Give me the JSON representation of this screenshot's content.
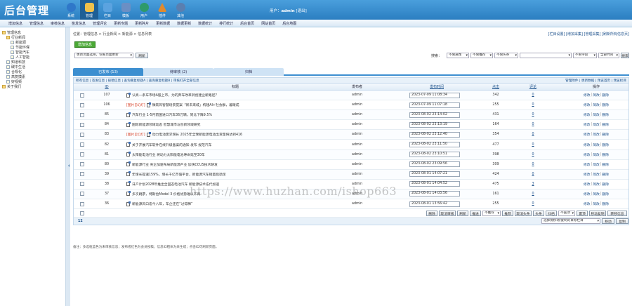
{
  "app": {
    "title": "后台管理"
  },
  "topnav": [
    {
      "label": "系统",
      "color": "#2f77c9"
    },
    {
      "label": "管理",
      "color": "#f0c14b"
    },
    {
      "label": "栏目",
      "color": "#5ba3e0"
    },
    {
      "label": "模板",
      "color": "#6b8fc4"
    },
    {
      "label": "用户",
      "color": "#2e9a6b"
    },
    {
      "label": "插件",
      "color": "#e08a2e"
    },
    {
      "label": "其他",
      "color": "#5a7fb0"
    }
  ],
  "user": {
    "prefix": "用户：",
    "name": "admin",
    "logout": "[退出]"
  },
  "subnav": [
    "增加信息",
    "管理信息",
    "审核信息",
    "签发信息",
    "管理评论",
    "更新专题",
    "更新碎片",
    "更新数据",
    "数据更新",
    "数据统计",
    "排行统计",
    "后台首页",
    "网站首页",
    "后台地图"
  ],
  "sidebar": [
    {
      "label": "管理信息",
      "indent": 0,
      "open": true
    },
    {
      "label": "行业新闻",
      "indent": 1,
      "open": true
    },
    {
      "label": "新能源",
      "indent": 2,
      "open": false
    },
    {
      "label": "节能环保",
      "indent": 2,
      "open": false
    },
    {
      "label": "智能汽车",
      "indent": 2,
      "open": false
    },
    {
      "label": "人工智能",
      "indent": 2,
      "open": false
    },
    {
      "label": "知道科技",
      "indent": 1,
      "open": false
    },
    {
      "label": "碳中生活",
      "indent": 1,
      "open": false
    },
    {
      "label": "合规化",
      "indent": 1,
      "open": false
    },
    {
      "label": "高复摸素",
      "indent": 1,
      "open": false
    },
    {
      "label": "好视频",
      "indent": 1,
      "open": false
    },
    {
      "label": "关于我们",
      "indent": 0,
      "open": false
    }
  ],
  "breadcrumb": "位置：管理信息 > 行业新闻 > 新能源 > 信息列表",
  "quicklinks": "[栏目设置] [增加采集] [管理采集] [刷新所有信息页]",
  "add_button": "增加信息",
  "filters": {
    "left_select": "更新页面选择，仅被页面更新",
    "refresh": "刷新",
    "search_label": "搜索：",
    "sel1": "不限属性",
    "sel2": "不限推荐",
    "sel3": "不限头条",
    "sel4": "不限字段",
    "sel5": "全部时间",
    "search_btn": "搜索"
  },
  "tabs": [
    {
      "label": "已发布 (13)",
      "active": true
    },
    {
      "label": "待审核 (2)",
      "active": false
    },
    {
      "label": "归档",
      "active": false
    }
  ],
  "opbar": {
    "left": "所有信息 | 签发信息 | 投稿信息 | 查询重复标题A | 查询重复标题B | 审核打开全部信息",
    "right": "管理附件 | 更新数据 | 预览首页 | 预览栏目"
  },
  "columns": {
    "id": "ID",
    "title": "标题",
    "publisher": "发布者",
    "time": "发布时间",
    "views": "点击",
    "comments": "评论",
    "ops": "操作"
  },
  "rows": [
    {
      "id": "107",
      "tag": "",
      "title": "认真一条车市场A股上市，为的奔车改革到创建业新路径?",
      "publisher": "admin",
      "time": "2023-07-09 11:08:34",
      "views": "342",
      "comments": "0"
    },
    {
      "id": "106",
      "tag": "[图片][幻灯]",
      "title": "微软风智慧场景提案「新未来城」构建AI+社会群，着眼成",
      "publisher": "admin",
      "time": "2023-07-09 11:07:18",
      "views": "255",
      "comments": "0"
    },
    {
      "id": "85",
      "tag": "",
      "title": "汽车行业 1-5月前国进口汽车36万辆，同比下降9.5%",
      "publisher": "admin",
      "time": "2023-08-02 23:14:02",
      "views": "431",
      "comments": "0"
    },
    {
      "id": "84",
      "tag": "",
      "title": "国际新能源领域动态 智慧城市与创新领域研究",
      "publisher": "admin",
      "time": "2023-08-02 23:13:19",
      "views": "164",
      "comments": "0"
    },
    {
      "id": "83",
      "tag": "[图片][幻灯]",
      "title": "动力电池需求增长 2025年全球新能源电池出货量将达到416",
      "publisher": "admin",
      "time": "2023-08-02 23:12:40",
      "views": "354",
      "comments": "0"
    },
    {
      "id": "82",
      "tag": "",
      "title": "关于开展汽车软件在线升级备案的通知 发布 规范汽车",
      "publisher": "admin",
      "time": "2023-08-02 23:11:50",
      "views": "477",
      "comments": "0"
    },
    {
      "id": "81",
      "tag": "",
      "title": "太阳能电池行业 将动力太阳能电池寿命延至30年",
      "publisher": "admin",
      "time": "2023-08-02 23:10:51",
      "views": "398",
      "comments": "0"
    },
    {
      "id": "80",
      "tag": "",
      "title": "新能源行业 央企加速布局新能源产业 加快CCUS技术研发",
      "publisher": "admin",
      "time": "2023-08-02 23:09:56",
      "views": "309",
      "comments": "0"
    },
    {
      "id": "39",
      "tag": "",
      "title": "年增长提速159%，增长千亿市值平台，新能源汽车销量后劲足",
      "publisher": "admin",
      "time": "2023-08-01 14:07:21",
      "views": "424",
      "comments": "0"
    },
    {
      "id": "38",
      "tag": "",
      "title": "日产计划2028年推出全固态电池汽车 新能源技术迭代加速",
      "publisher": "admin",
      "time": "2023-08-01 14:04:52",
      "views": "475",
      "comments": "3"
    },
    {
      "id": "37",
      "tag": "",
      "title": "多次跳票，特斯拉Model 3 价格优势难以不再",
      "publisher": "admin",
      "time": "2023-08-01 14:03:56",
      "views": "161",
      "comments": "0"
    },
    {
      "id": "36",
      "tag": "",
      "title": "新能源风口迄今八年，车企还在“过得稀”",
      "publisher": "admin",
      "time": "2023-08-01 13:56:42",
      "views": "255",
      "comments": "0"
    }
  ],
  "row_ops": {
    "edit": "修改",
    "simple_edit": "简改",
    "delete": "删除"
  },
  "bulk": [
    "删除",
    "取消审核",
    "刷新",
    "推送",
    "不推荐",
    "推荐",
    "取消头条",
    "头条",
    "归档",
    "不置顶",
    "置顶",
    "移动复制",
    "转移信息"
  ],
  "pager": {
    "page": "12",
    "move_select": "选择要移动/复制的目标栏目",
    "move": "移动",
    "copy": "复制"
  },
  "note": "备注：多选框蓝色为未审核信息；发布者红色为会员投稿；信息ID粗体为未生成；点击ID可刷新页面。",
  "watermark": "https://www.huzhan.com/ishop663"
}
